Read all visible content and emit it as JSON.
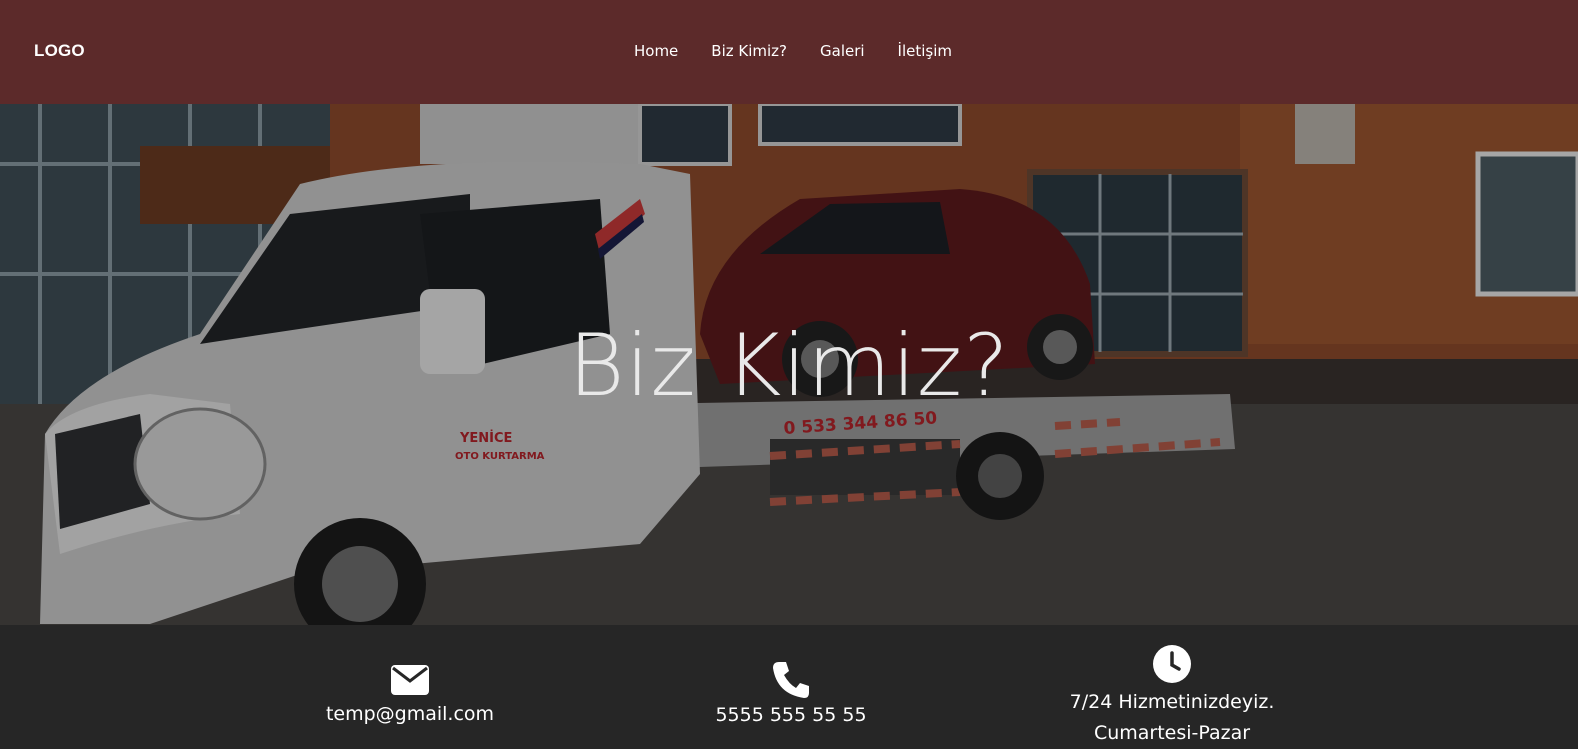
{
  "navbar": {
    "logo": "LOGO",
    "links": [
      "Home",
      "Biz Kimiz?",
      "Galeri",
      "İletişim"
    ],
    "bg_color": "#5c2a2a"
  },
  "hero": {
    "title": "Biz Kimiz?",
    "truck_phone": "0 533 344 86 50",
    "truck_brand_line1": "YENİCE",
    "truck_brand_line2": "OTO KURTARMA"
  },
  "contact": {
    "email": {
      "icon": "envelope-icon",
      "text": "temp@gmail.com"
    },
    "phone": {
      "icon": "phone-icon",
      "text": "5555 555 55 55"
    },
    "hours": {
      "icon": "clock-icon",
      "line1": "7/24 Hizmetinizdeyiz.",
      "line2": "Cumartesi-Pazar"
    },
    "bg_color": "#262626"
  }
}
